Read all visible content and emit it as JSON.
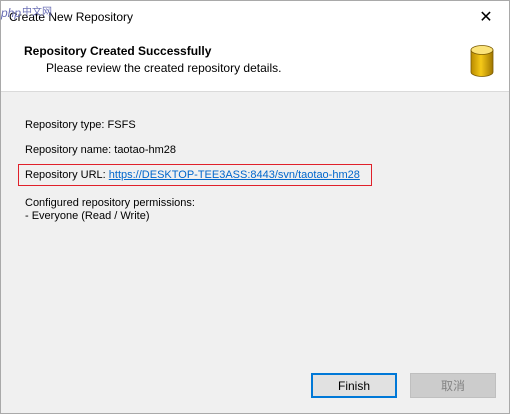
{
  "window": {
    "title": "Create New Repository",
    "close_glyph": "✕"
  },
  "watermark": {
    "text_php": "php",
    "text_cn": "中文网"
  },
  "header": {
    "title": "Repository Created Successfully",
    "subtitle": "Please review the created repository details.",
    "icon": "database-icon"
  },
  "details": {
    "type_line": "Repository type: FSFS",
    "name_line": "Repository name: taotao-hm28",
    "url_label": "Repository URL: ",
    "url_value": "https://DESKTOP-TEE3ASS:8443/svn/taotao-hm28",
    "permissions_title": "Configured repository permissions:",
    "permissions_entry": "- Everyone (Read / Write)"
  },
  "buttons": {
    "finish": "Finish",
    "cancel": "取消"
  },
  "colors": {
    "accent": "#0078d7",
    "highlight_border": "#e0202a",
    "link": "#0066cc"
  }
}
